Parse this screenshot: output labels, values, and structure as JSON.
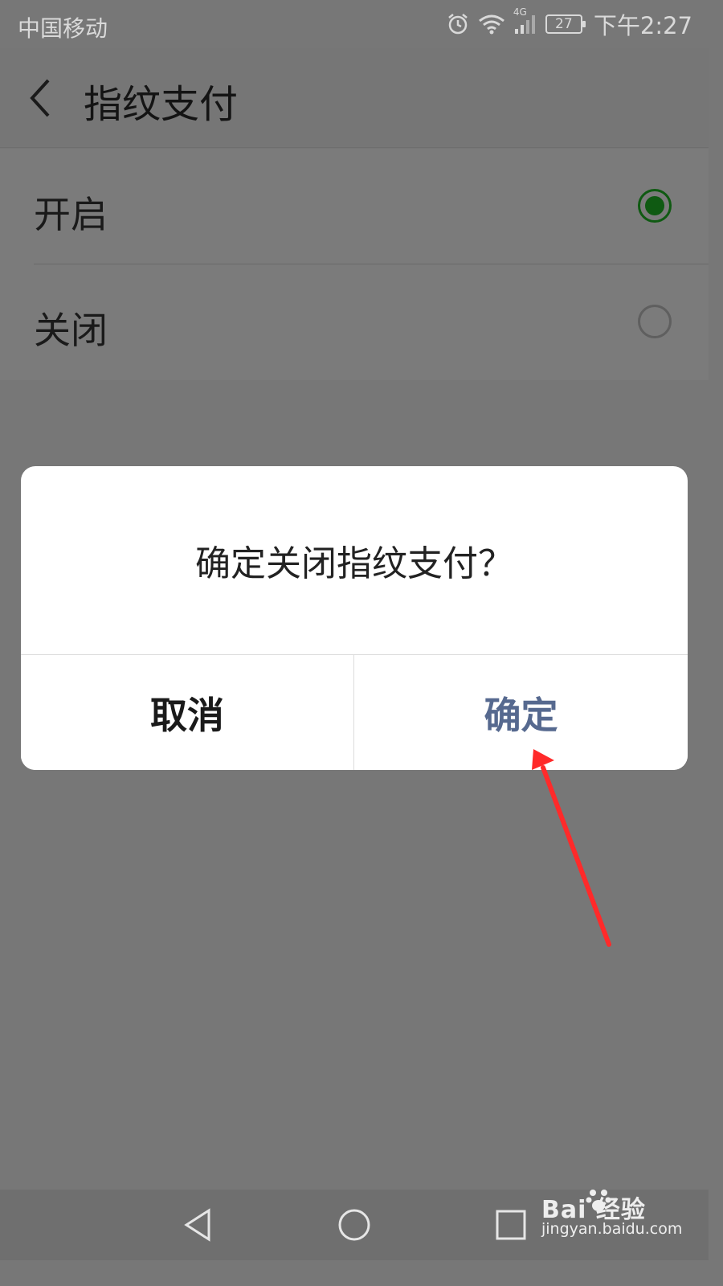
{
  "status_bar": {
    "carrier": "中国移动",
    "network": "4G",
    "battery": "27",
    "time": "下午2:27"
  },
  "header": {
    "title": "指纹支付"
  },
  "options": [
    {
      "label": "开启",
      "selected": true
    },
    {
      "label": "关闭",
      "selected": false
    }
  ],
  "dialog": {
    "message": "确定关闭指纹支付？",
    "cancel_label": "取消",
    "confirm_label": "确定"
  },
  "watermark": {
    "brand_text": "Bai  经验",
    "site": "jingyan.baidu.com"
  },
  "colors": {
    "radio_selected": "#0f5a12",
    "confirm_text": "#56698f",
    "annotation_arrow": "#ff2a2a"
  }
}
